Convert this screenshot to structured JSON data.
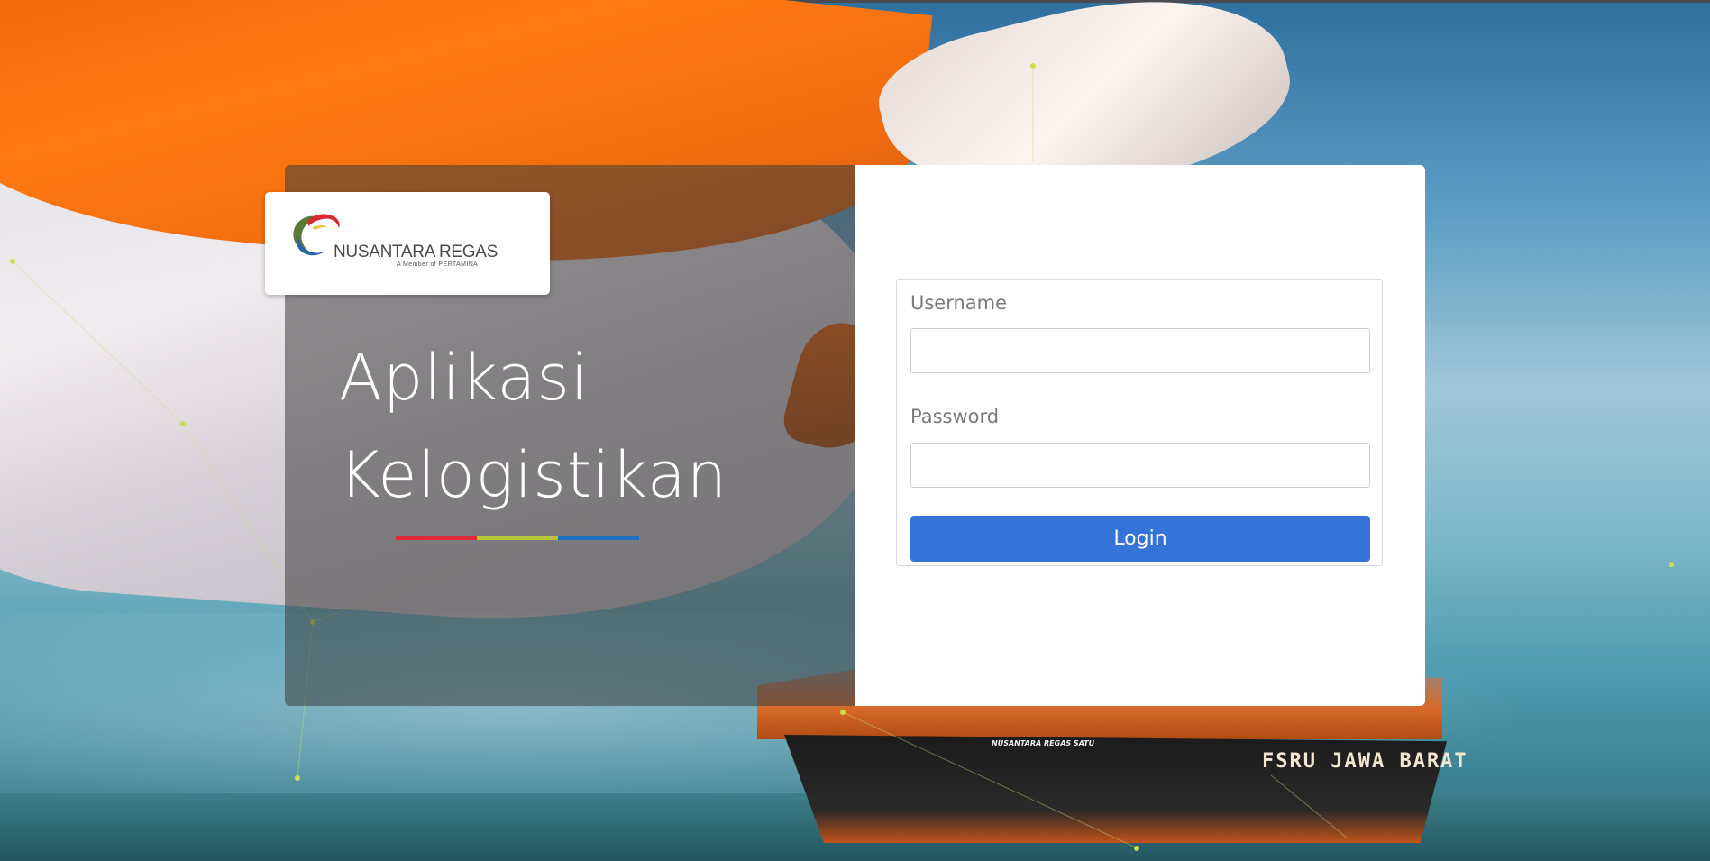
{
  "branding": {
    "company_name": "NUSANTARA REGAS",
    "tagline": "A Member of PERTAMINA"
  },
  "hero": {
    "title_line1": "Aplikasi",
    "title_line2": "Kelogistikan",
    "stripe_colors": [
      "#e02a3a",
      "#b5c738",
      "#1e6fc0"
    ]
  },
  "background": {
    "ship_name": "NUSANTARA REGAS SATU",
    "ship_hull_text": "FSRU JAWA BARAT"
  },
  "login_form": {
    "username_label": "Username",
    "username_value": "",
    "password_label": "Password",
    "password_value": "",
    "submit_label": "Login",
    "button_color": "#3474d8"
  }
}
